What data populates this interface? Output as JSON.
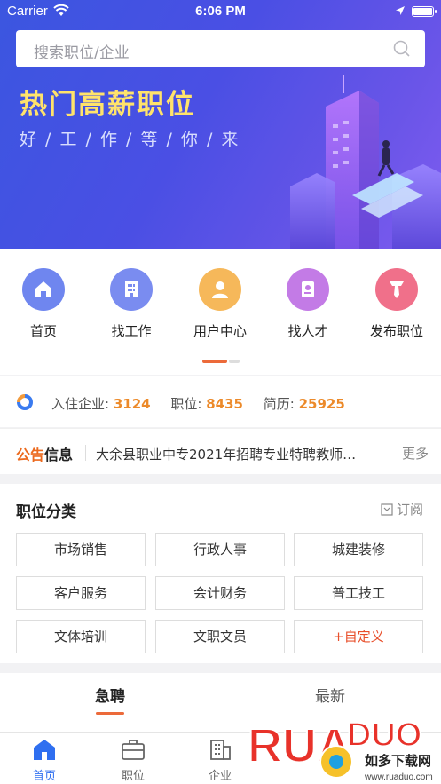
{
  "status_bar": {
    "carrier": "Carrier",
    "time": "6:06 PM"
  },
  "search": {
    "placeholder": "搜索职位/企业"
  },
  "banner": {
    "title": "热门高薪职位",
    "subtitle": "好 / 工 / 作 / 等 / 你 / 来"
  },
  "quick_nav": [
    {
      "label": "首页",
      "icon": "home-icon",
      "color": "#6f86ef"
    },
    {
      "label": "找工作",
      "icon": "building-icon",
      "color": "#7a8cf0"
    },
    {
      "label": "用户中心",
      "icon": "user-icon",
      "color": "#f6b85a"
    },
    {
      "label": "找人才",
      "icon": "badge-icon",
      "color": "#c37be6"
    },
    {
      "label": "发布职位",
      "icon": "tie-icon",
      "color": "#f0708a"
    }
  ],
  "stats": {
    "companies_label": "入住企业:",
    "companies_value": "3124",
    "jobs_label": "职位:",
    "jobs_value": "8435",
    "resumes_label": "简历:",
    "resumes_value": "25925"
  },
  "notice": {
    "tag_a": "公告",
    "tag_b": "信息",
    "text": "大余县职业中专2021年招聘专业特聘教师…",
    "more": "更多"
  },
  "categories": {
    "title": "职位分类",
    "subscribe": "订阅",
    "items": [
      "市场销售",
      "行政人事",
      "城建装修",
      "客户服务",
      "会计财务",
      "普工技工",
      "文体培训",
      "文职文员",
      "+自定义"
    ]
  },
  "tabs": {
    "urgent": "急聘",
    "latest": "最新"
  },
  "bottom_nav": [
    {
      "label": "首页",
      "icon": "home-icon",
      "active": true
    },
    {
      "label": "职位",
      "icon": "briefcase-icon",
      "active": false
    },
    {
      "label": "企业",
      "icon": "company-icon",
      "active": false
    }
  ],
  "watermark": {
    "brand": "RUANDUO",
    "site_cn": "如多下载网",
    "site_url": "www.ruaduo.com"
  },
  "colors": {
    "accent": "#ec6a3a",
    "nav_active": "#2f6ff0",
    "stat_number": "#ec8a2a",
    "banner_title": "#ffe36b"
  }
}
